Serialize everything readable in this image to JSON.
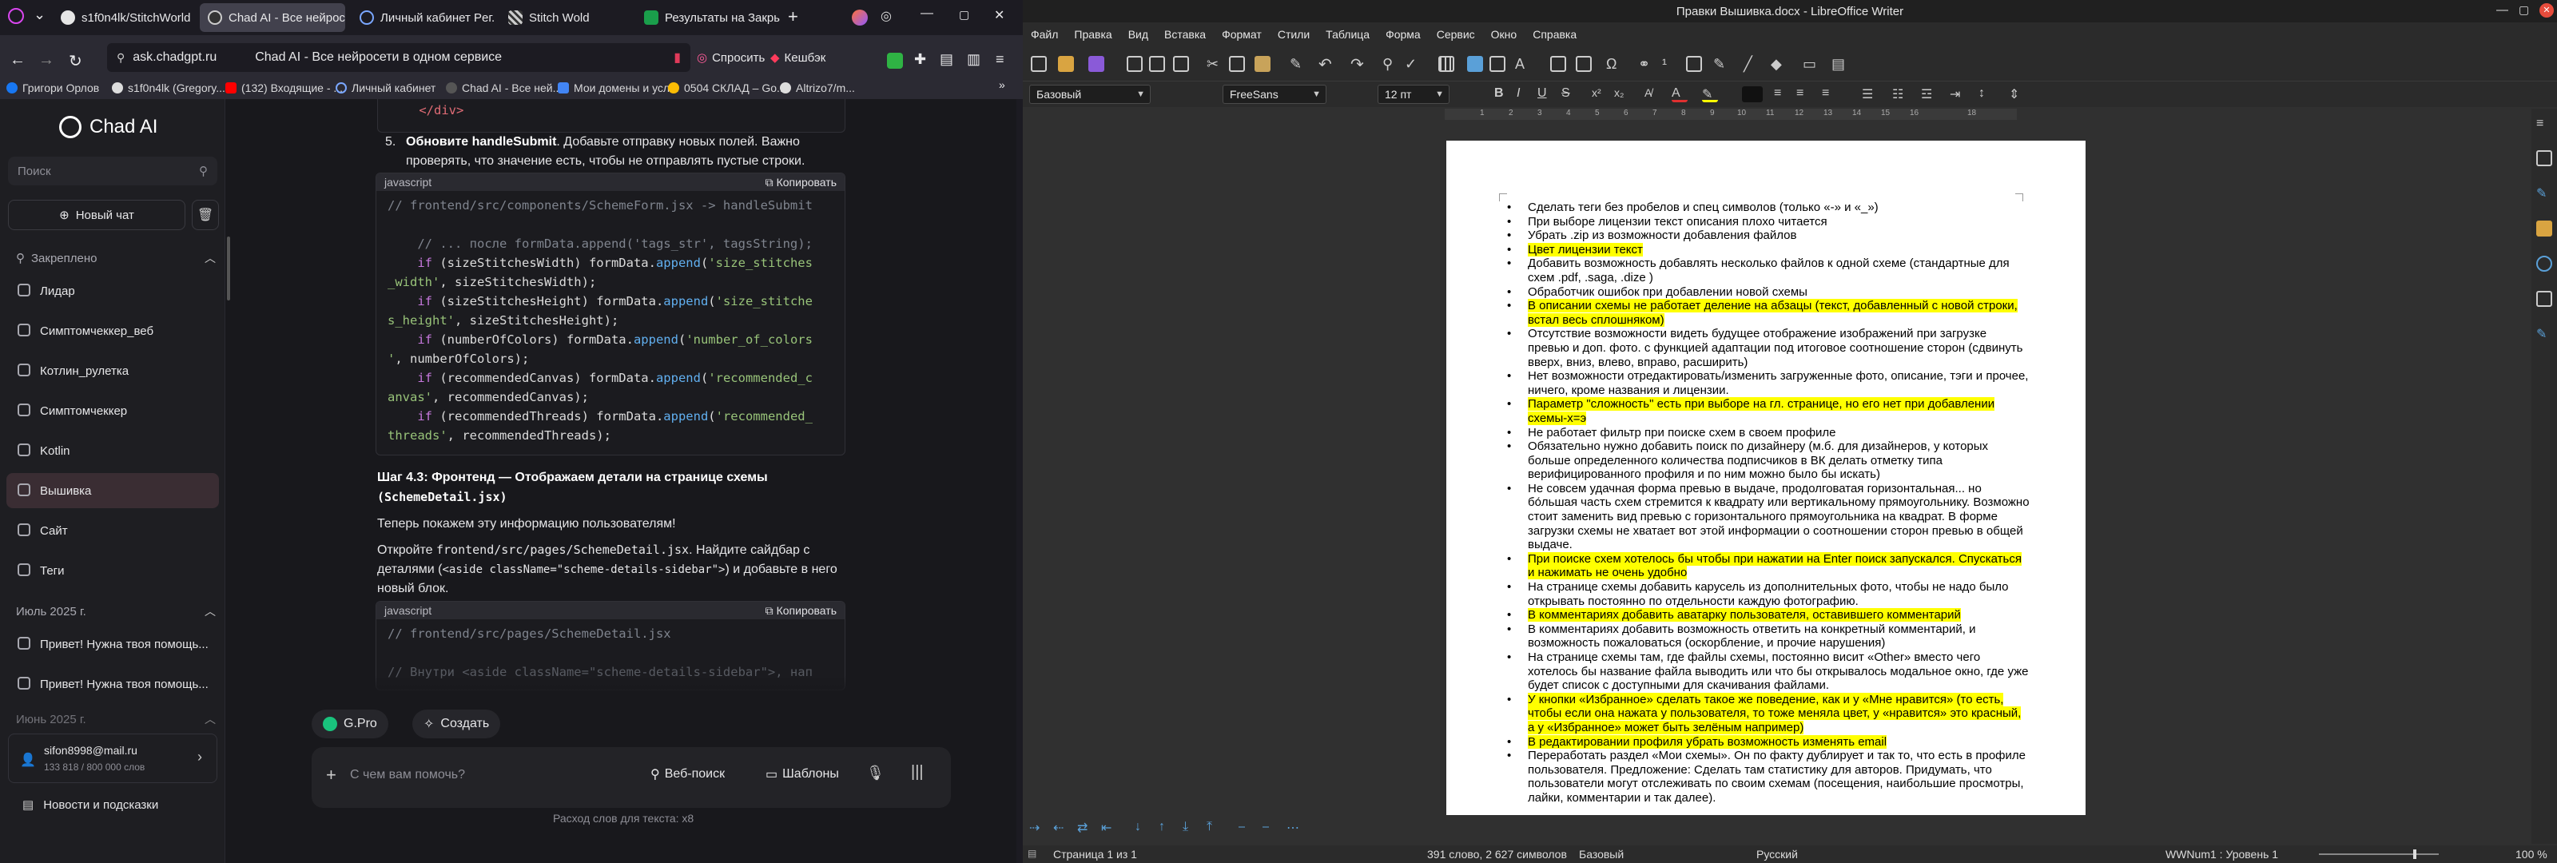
{
  "browser": {
    "tabs": [
      {
        "title": "s1f0n4lk/StitchWorld"
      },
      {
        "title": "Chad AI - Все нейросе"
      },
      {
        "title": "Личный кабинет Peг.ru"
      },
      {
        "title": "Stitch Wold"
      },
      {
        "title": "Результаты на Закрыт"
      }
    ],
    "url": "ask.chadgpt.ru",
    "page_title": "Chad AI - Все нейросети в одном сервисе",
    "toolbar": {
      "ask_label": "Спросить",
      "cashback_label": "Кешбэк"
    },
    "bookmarks": [
      "Григори Орлов",
      "s1f0n4lk (Gregory...",
      "(132) Входящие - ...",
      "Личный кабинет",
      "Chad AI - Все ней...",
      "Мои домены и усл...",
      "0504 СКЛАД – Go...",
      "Altrizo7/m..."
    ]
  },
  "sidebar": {
    "brand": "Chad AI",
    "search_placeholder": "Поиск",
    "new_chat_label": "Новый чат",
    "pinned_header": "Закреплено",
    "pinned_items": [
      "Лидар",
      "Симптомчеккер_веб",
      "Котлин_рулетка",
      "Симптомчеккер",
      "Kotlin",
      "Вышивка",
      "Сайт",
      "Теги"
    ],
    "section_july": "Июль 2025 г.",
    "july_items": [
      "Привет! Нужна твоя помощь...",
      "Привет! Нужна твоя помощь..."
    ],
    "section_june": "Июнь 2025 г.",
    "user_email": "sifon8998@mail.ru",
    "user_words": "133 818 / 800 000 слов",
    "news_label": "Новости и подсказки"
  },
  "chat": {
    "step5_number": "5.",
    "step5_bold": "Обновите handleSubmit",
    "step5_text": ". Добавьте отправку новых полей. Важно проверять, что значение есть, чтобы не отправлять пустые строки.",
    "code1_lang": "javascript",
    "copy_label": "Копировать",
    "code1_comment": "// frontend/src/components/SchemeForm.jsx -> handleSubmit",
    "step43_title": "Шаг 4.3: Фронтенд — Отображаем детали на странице схемы",
    "step43_file": "(SchemeDetail.jsx)",
    "step43_p1": "Теперь покажем эту информацию пользователям!",
    "step43_p2_a": "Откройте ",
    "step43_p2_file": "frontend/src/pages/SchemeDetail.jsx",
    "step43_p2_b": ". Найдите сайдбар с деталями (",
    "step43_p2_code": "<aside className=\"scheme-details-sidebar\">",
    "step43_p2_c": ") и добавьте в него новый блок.",
    "code2_lang": "javascript",
    "code2_comment": "// frontend/src/pages/SchemeDetail.jsx",
    "code2_comment2": "// Внутри <aside className=\"scheme-details-sidebar\">, нап",
    "model_label": "G.Pro",
    "create_label": "Создать",
    "input_placeholder": "С чем вам помочь?",
    "web_search_label": "Веб-поиск",
    "templates_label": "Шаблоны",
    "word_usage": "Расход слов для текста: x8"
  },
  "writer": {
    "title": "Правки Вышивка.docx - LibreOffice Writer",
    "menu": [
      "Файл",
      "Правка",
      "Вид",
      "Вставка",
      "Формат",
      "Стили",
      "Таблица",
      "Форма",
      "Сервис",
      "Окно",
      "Справка"
    ],
    "style_name": "Базовый",
    "font_name": "FreeSans",
    "font_size": "12 пт",
    "ruler_marks": [
      "1",
      "2",
      "3",
      "4",
      "5",
      "6",
      "7",
      "8",
      "9",
      "10",
      "11",
      "12",
      "13",
      "14",
      "15",
      "16",
      "18"
    ],
    "status": {
      "page": "Страница 1 из 1",
      "words": "391 слово, 2 627 символов",
      "style": "Базовый",
      "lang": "Русский",
      "outline": "WWNum1 : Уровень 1",
      "zoom": "100 %"
    },
    "highlight_color": "#ffff00",
    "items": [
      {
        "text": "Сделать теги без пробелов и спец символов (только «-» и «_»)",
        "hl": false
      },
      {
        "text": "При выборе лицензии текст описания плохо читается",
        "hl": false
      },
      {
        "text": "Убрать .zip из возможности добавления файлов",
        "hl": false
      },
      {
        "text": "Цвет лицензии текст",
        "hl": true
      },
      {
        "text": "Добавить возможность добавлять несколько файлов к одной схеме (стандартные для схем .pdf, .saga, .dize )",
        "hl": false
      },
      {
        "text": "Обработчик ошибок при добавлении новой схемы",
        "hl": false
      },
      {
        "text": "В описании схемы не работает деление на абзацы (текст, добавленный с новой строки, встал весь сплошняком)",
        "hl": true
      },
      {
        "text": "Отсутствие возможности видеть будущее отображение изображений при загрузке превью и доп. фото. с функцией адаптации под итоговое соотношение сторон (сдвинуть вверх, вниз, влево, вправо, расширить)",
        "hl": false
      },
      {
        "text": "Нет возможности отредактировать/изменить загруженные фото, описание, тэги и прочее, ничего, кроме названия и лицензии.",
        "hl": false
      },
      {
        "text": "Параметр \"сложность\" есть при выборе на гл. странице, но его нет при добавлении схемы-х=э",
        "hl": true
      },
      {
        "text": "Не работает фильтр при поиске схем в своем профиле",
        "hl": false
      },
      {
        "text": "Обязательно нужно добавить поиск по дизайнеру (м.б. для дизайнеров, у которых больше определенного количества подписчиков в ВК делать отметку типа верифицированного профиля и по ним можно было бы искать)",
        "hl": false
      },
      {
        "text": "Не совсем удачная форма превью в выдаче, продолговатая горизонтальная... но бо́льшая часть схем стремится к квадрату или вертикальному прямоугольнику. Возможно стоит заменить вид превью с горизонтального прямоугольника на квадрат. В форме загрузки схемы не хватает вот этой информации о соотношении сторон превью в общей выдаче.",
        "hl": false
      },
      {
        "text": "При поиске схем хотелось бы чтобы при нажатии на Enter поиск запускался. Спускаться и нажимать не очень удобно",
        "hl": true
      },
      {
        "text": "На странице схемы добавить карусель из дополнительных фото, чтобы не надо было открывать постоянно по отдельности каждую фотографию.",
        "hl": false
      },
      {
        "text": "В комментариях добавить аватарку пользователя, оставившего комментарий",
        "hl": true
      },
      {
        "text": "В комментариях добавить возможность ответить на конкретный комментарий, и возможность пожаловаться (оскорбление, и прочие нарушения)",
        "hl": false
      },
      {
        "text": "На странице схемы там, где файлы схемы, постоянно висит «Other» вместо чего хотелось бы название файла выводить или что бы открывалось модальное окно, где уже будет список с доступными для скачивания файлами.",
        "hl": false
      },
      {
        "text": "У кнопки «Избранное» сделать такое же поведение, как и у «Мне нравится» (то есть, чтобы если она нажата у пользователя, то тоже меняла цвет, у «нравится» это красный, а у «Избранное» может быть зелёным например)",
        "hl": true
      },
      {
        "text": "В редактировании профиля убрать возможность изменять email",
        "hl": true
      },
      {
        "text": "Переработать раздел «Мои схемы». Он по факту дублирует и так то, что есть в профиле пользователя. Предложение: Сделать там статистику для авторов. Придумать, что пользователи могут отслеживать по своим схемам (посещения, наибольшие просмотры, лайки, комментарии и так далее).",
        "hl": false
      }
    ]
  }
}
